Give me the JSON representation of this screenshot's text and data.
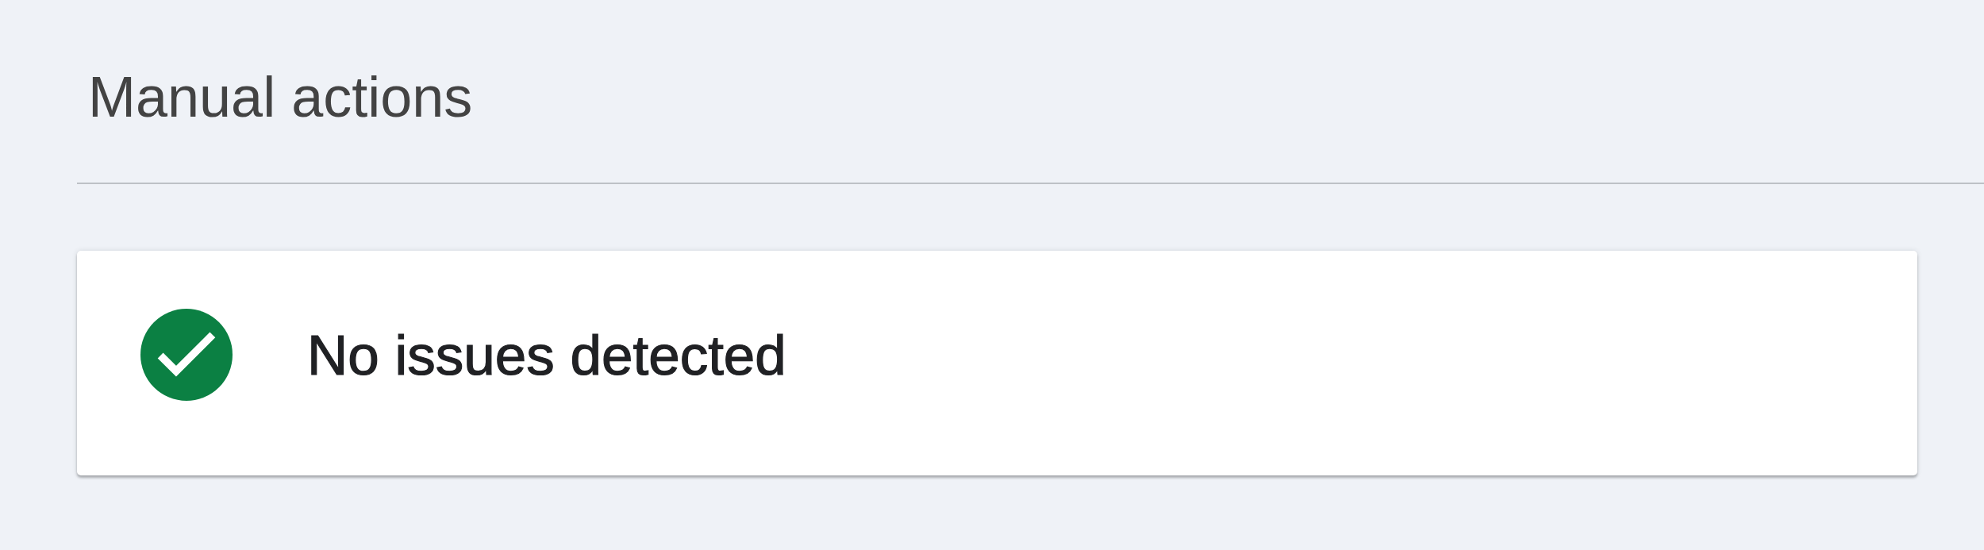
{
  "page": {
    "title": "Manual actions"
  },
  "status_card": {
    "ok": true,
    "message": "No issues detected"
  }
}
